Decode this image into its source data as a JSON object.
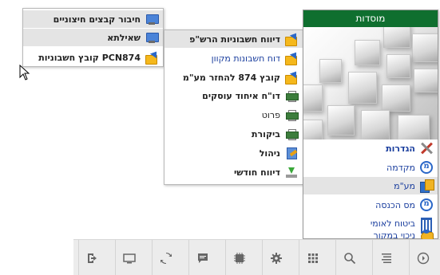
{
  "main_menu": {
    "title": "מוסדות",
    "header_color": "#0f6f2f",
    "items": [
      {
        "label": "הגדרות",
        "icon": "tools-icon"
      },
      {
        "label": "מקדמה",
        "icon": "circle-m-icon"
      },
      {
        "label": "מע\"מ",
        "icon": "calculator-icon"
      },
      {
        "label": "מס הכנסה",
        "icon": "circle-m-icon"
      },
      {
        "label": "ביטוח לאומי",
        "icon": "pillar-icon"
      },
      {
        "label": "ניכוי במקור",
        "icon": "hand-coins-icon"
      }
    ]
  },
  "sub_menu": {
    "items": [
      {
        "label": "דיווח חשבוניות הרש\"פ",
        "icon": "folder-arrow-icon"
      },
      {
        "label": "דוח חשבונות מקוון",
        "icon": "folder-arrow-icon"
      },
      {
        "label": "קובץ 874 להחזר מע\"מ",
        "icon": "folder-arrow-icon"
      },
      {
        "label": "דו\"ח איחוד עוסקים",
        "icon": "printer-icon"
      },
      {
        "label": "פרוט",
        "icon": "printer-icon"
      },
      {
        "label": "ביקורת",
        "icon": "printer-icon"
      },
      {
        "label": "ניהול",
        "icon": "form-icon"
      },
      {
        "label": "דיווח חודשי",
        "icon": "download-icon"
      }
    ]
  },
  "sub_sub_menu": {
    "items": [
      {
        "label": "חיבור קבצים חיצוניים",
        "icon": "monitor-icon"
      },
      {
        "label": "שאילתא",
        "icon": "monitor-icon"
      },
      {
        "label": "קובץ חשבוניות PCN874",
        "icon": "folder-arrow-icon"
      }
    ]
  },
  "toolbar": {
    "buttons": [
      "exit-icon",
      "monitor-icon",
      "refresh-icon",
      "chat-icon",
      "chip-icon",
      "gear-icon",
      "grid-icon",
      "search-icon",
      "list-icon",
      "circle-arrow-icon"
    ]
  }
}
